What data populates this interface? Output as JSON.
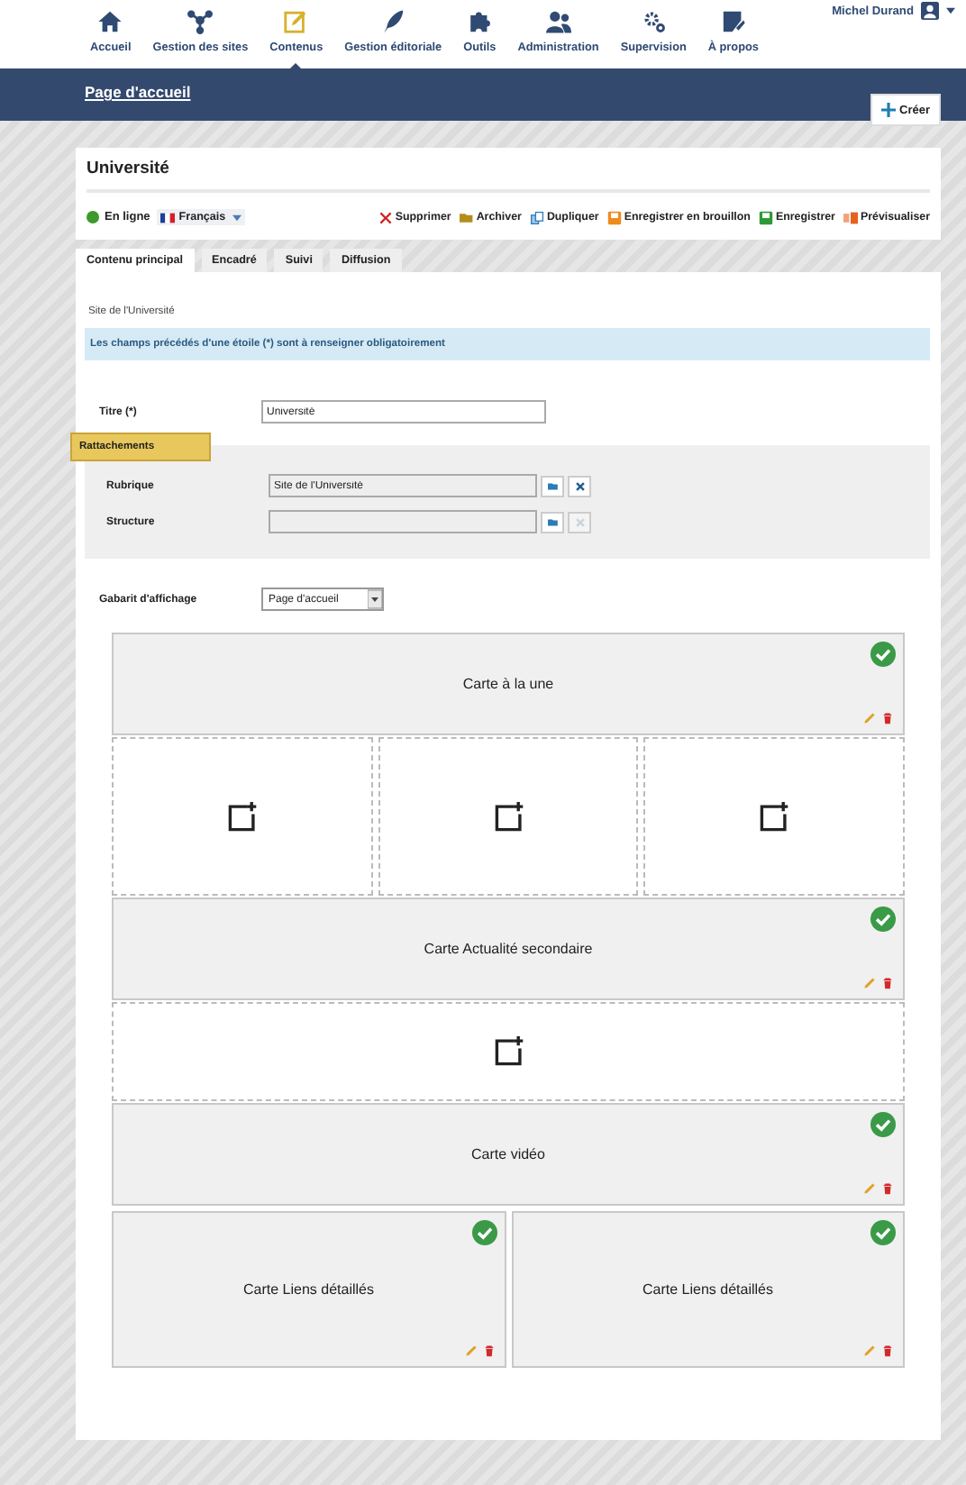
{
  "nav": {
    "items": [
      {
        "label": "Accueil",
        "kind": "home",
        "selected": false
      },
      {
        "label": "Gestion des sites",
        "kind": "network",
        "selected": false
      },
      {
        "label": "Contenus",
        "kind": "edit",
        "selected": true
      },
      {
        "label": "Gestion éditoriale",
        "kind": "feather",
        "selected": false
      },
      {
        "label": "Outils",
        "kind": "puzzle",
        "selected": false
      },
      {
        "label": "Administration",
        "kind": "users",
        "selected": false
      },
      {
        "label": "Supervision",
        "kind": "gears",
        "selected": false
      },
      {
        "label": "À propos",
        "kind": "note",
        "selected": false
      }
    ],
    "user": "Michel Durand"
  },
  "breadcrumb": "Page d'accueil",
  "create_button": "Créer",
  "page": {
    "title": "Université",
    "status": "En ligne",
    "online": true,
    "language": "Français"
  },
  "actions": [
    {
      "label": "Supprimer",
      "kind": "delete"
    },
    {
      "label": "Archiver",
      "kind": "archive"
    },
    {
      "label": "Dupliquer",
      "kind": "duplicate"
    },
    {
      "label": "Enregistrer en brouillon",
      "kind": "draft"
    },
    {
      "label": "Enregistrer",
      "kind": "save"
    },
    {
      "label": "Prévisualiser",
      "kind": "preview"
    }
  ],
  "tabs": [
    {
      "label": "Contenu principal",
      "selected": true
    },
    {
      "label": "Encadré",
      "selected": false
    },
    {
      "label": "Suivi",
      "selected": false
    },
    {
      "label": "Diffusion",
      "selected": false
    }
  ],
  "site": "Site de l'Université",
  "notice": "Les champs précédés d'une étoile (*) sont à renseigner obligatoirement",
  "title_field": {
    "label": "Titre (*)",
    "value": "Université"
  },
  "attachments": {
    "heading": "Rattachements",
    "fields": [
      {
        "label": "Rubrique",
        "value": "Site de l'Université",
        "clear_disabled": false
      },
      {
        "label": "Structure",
        "clear_disabled": true
      }
    ]
  },
  "template": {
    "label": "Gabarit d'affichage",
    "value": "Page d'accueil"
  },
  "layout": [
    {
      "cells": [
        {
          "kind": "card",
          "title": "Carte à la une",
          "valid": true
        }
      ]
    },
    {
      "cells": [
        {
          "kind": "empty"
        },
        {
          "kind": "empty"
        },
        {
          "kind": "empty"
        }
      ]
    },
    {
      "cells": [
        {
          "kind": "card",
          "title": "Carte Actualité secondaire",
          "valid": true
        }
      ]
    },
    {
      "cells": [
        {
          "kind": "empty"
        }
      ]
    },
    {
      "cells": [
        {
          "kind": "card",
          "title": "Carte vidéo",
          "valid": true
        }
      ]
    },
    {
      "cells": [
        {
          "kind": "card",
          "title": "Carte Liens détaillés",
          "valid": true
        },
        {
          "kind": "card",
          "title": "Carte Liens détaillés",
          "valid": true
        }
      ]
    }
  ]
}
